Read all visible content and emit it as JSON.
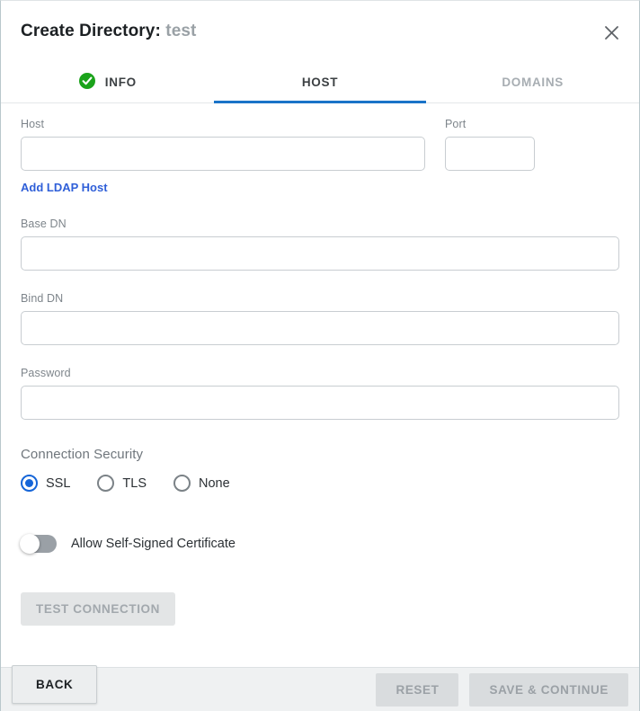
{
  "dialog": {
    "title_prefix": "Create Directory:",
    "title_name": "test",
    "close_icon": "close-icon"
  },
  "tabs": [
    {
      "label": "INFO",
      "state": "completed",
      "icon": "check-circle-icon"
    },
    {
      "label": "HOST",
      "state": "active",
      "icon": ""
    },
    {
      "label": "DOMAINS",
      "state": "disabled",
      "icon": ""
    }
  ],
  "form": {
    "host": {
      "label": "Host",
      "value": "",
      "placeholder": ""
    },
    "port": {
      "label": "Port",
      "value": "",
      "placeholder": ""
    },
    "add_host_link": "Add LDAP Host",
    "base_dn": {
      "label": "Base DN",
      "value": "",
      "placeholder": ""
    },
    "bind_dn": {
      "label": "Bind DN",
      "value": "",
      "placeholder": ""
    },
    "password": {
      "label": "Password",
      "value": "",
      "placeholder": ""
    },
    "connection_security": {
      "label": "Connection Security",
      "selected": "SSL",
      "options": [
        {
          "label": "SSL",
          "checked": true
        },
        {
          "label": "TLS",
          "checked": false
        },
        {
          "label": "None",
          "checked": false
        }
      ]
    },
    "allow_self_signed": {
      "label": "Allow Self-Signed Certificate",
      "checked": false
    },
    "test_connection_button": "TEST CONNECTION"
  },
  "footer": {
    "back_label": "BACK",
    "reset_label": "RESET",
    "save_label": "SAVE & CONTINUE"
  },
  "colors": {
    "accent": "#1a73c8",
    "link": "#2f5fd8",
    "success": "#1ba31b",
    "radio_selected": "#1565d8",
    "disabled_text": "#a2a8ad"
  }
}
